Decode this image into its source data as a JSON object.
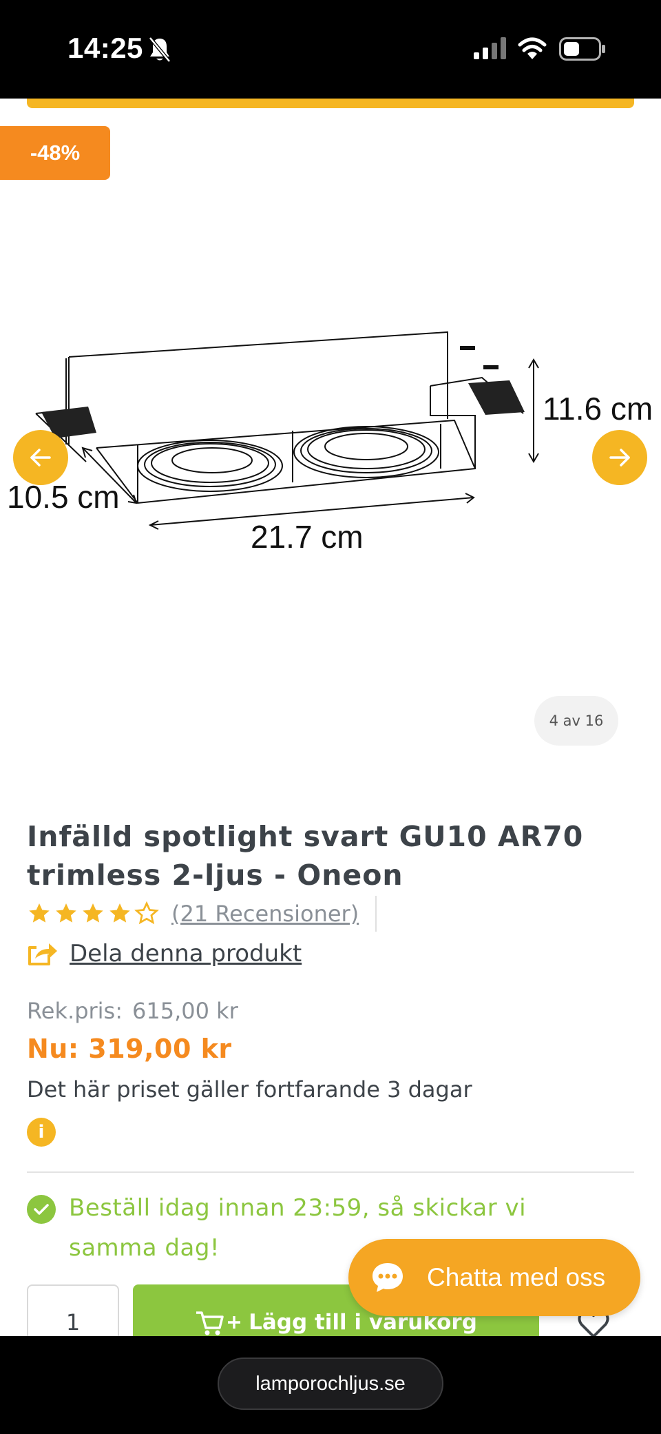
{
  "status_bar": {
    "time": "14:25",
    "icons": [
      "bell-slash-icon",
      "signal-icon",
      "wifi-icon",
      "battery-icon"
    ]
  },
  "product": {
    "discount_badge": "-48%",
    "image": {
      "dimension_height": "11.6 cm",
      "dimension_depth": "10.5 cm",
      "dimension_width": "21.7 cm",
      "counter": "4 av 16"
    },
    "title": "Infälld spotlight svart GU10 AR70 trimless 2-ljus - Oneon",
    "rating": {
      "value": 4.5,
      "max": 5,
      "reviews_label": "(21 Recensioner)"
    },
    "share_label": "Dela denna produkt",
    "pricing": {
      "rek_label": "Rek.pris:",
      "rek_value": "615,00 kr",
      "now": "Nu: 319,00 kr",
      "note": "Det här priset gäller fortfarande 3 dagar"
    },
    "shipping_notice": "Beställ idag innan 23:59, så skickar vi samma dag!",
    "quantity": "1",
    "add_to_cart_label": "Lägg till i varukorg"
  },
  "chat": {
    "label": "Chatta med oss"
  },
  "browser": {
    "url": "lamporochljus.se"
  },
  "colors": {
    "accent_yellow": "#f5b623",
    "discount_orange": "#f58a1f",
    "success_green": "#8cc63f",
    "chat_orange": "#f5a623"
  }
}
